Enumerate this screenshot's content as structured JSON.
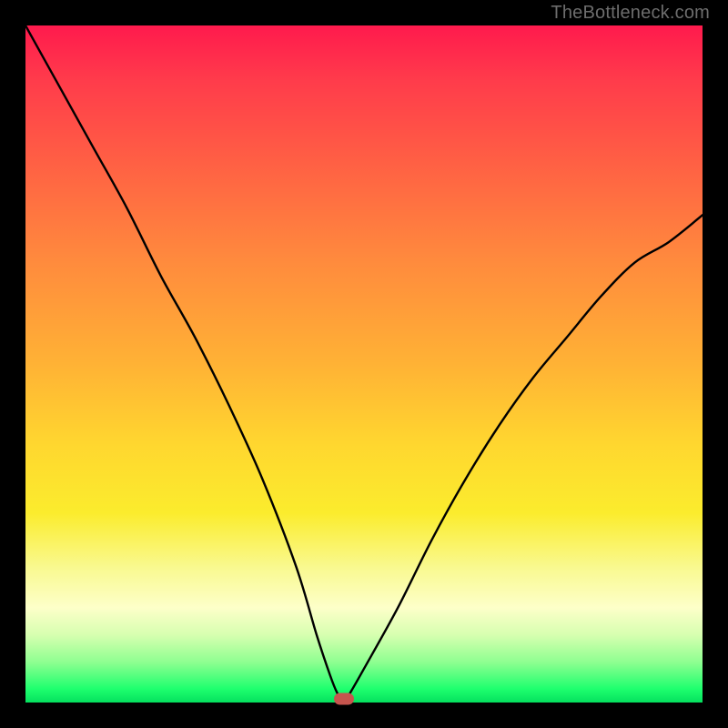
{
  "watermark": "TheBottleneck.com",
  "colors": {
    "frame": "#000000",
    "gradient_top": "#ff1a4d",
    "gradient_mid": "#ffd72f",
    "gradient_bottom": "#05e05e",
    "curve": "#000000",
    "marker": "#c6554e",
    "watermark_text": "#6d6d6d"
  },
  "chart_data": {
    "type": "line",
    "title": "",
    "xlabel": "",
    "ylabel": "",
    "xlim": [
      0,
      100
    ],
    "ylim": [
      0,
      100
    ],
    "grid": false,
    "legend": false,
    "series": [
      {
        "name": "bottleneck-curve",
        "x": [
          0,
          5,
          10,
          15,
          20,
          25,
          30,
          35,
          40,
          43,
          45,
          46,
          47,
          48,
          50,
          55,
          60,
          65,
          70,
          75,
          80,
          85,
          90,
          95,
          100
        ],
        "y": [
          100,
          91,
          82,
          73,
          63,
          54,
          44,
          33,
          20,
          10,
          4,
          1.5,
          0,
          1.5,
          5,
          14,
          24,
          33,
          41,
          48,
          54,
          60,
          65,
          68,
          72
        ]
      }
    ],
    "annotations": [
      {
        "name": "minimum-marker",
        "x": 47,
        "y": 0.5
      }
    ],
    "background": "vertical-gradient red→yellow→green"
  }
}
